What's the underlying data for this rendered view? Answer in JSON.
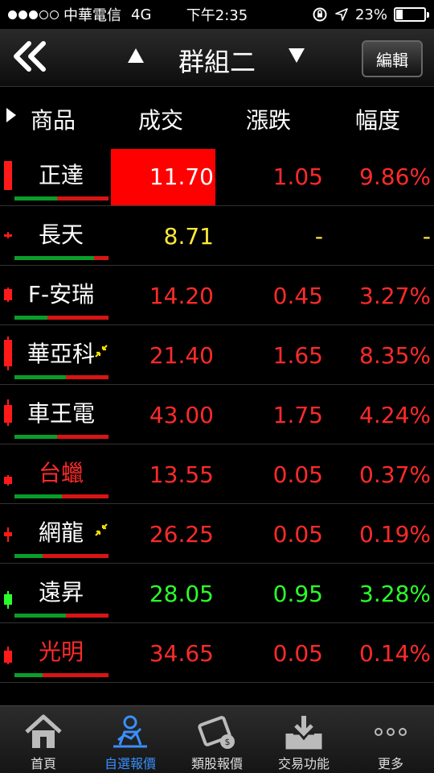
{
  "status": {
    "carrier": "中華電信",
    "network": "4G",
    "time": "下午2:35",
    "battery_pct": "23%",
    "battery_level": 0.23,
    "signal_bars_filled": 3,
    "signal_bars_total": 5
  },
  "header": {
    "back_label": "«",
    "title": "群組二",
    "prev_icon": "up-triangle-icon",
    "next_icon": "down-triangle-icon",
    "edit_label": "編輯"
  },
  "columns": {
    "name": "商品",
    "price": "成交",
    "change": "漲跌",
    "percent": "幅度"
  },
  "rows": [
    {
      "name": "正達",
      "name_color": "white",
      "price": "11.70",
      "price_color": "white",
      "price_highlight": true,
      "change": "1.05",
      "change_color": "red",
      "percent": "9.86%",
      "percent_color": "red",
      "flash": false,
      "green_ratio": 0.45,
      "candle_color": "#ff1a1a",
      "candle_wick": [
        0.1,
        0.9
      ],
      "candle_body": [
        0.1,
        0.9
      ]
    },
    {
      "name": "長天",
      "name_color": "white",
      "price": "8.71",
      "price_color": "yellow",
      "price_highlight": false,
      "change": "-",
      "change_color": "yellow",
      "percent": "-",
      "percent_color": "yellow",
      "flash": false,
      "green_ratio": 0.85,
      "candle_color": "#ff1a1a",
      "candle_wick": [
        0.4,
        0.6
      ],
      "candle_body": [
        0.47,
        0.53
      ]
    },
    {
      "name": "F-安瑞",
      "name_color": "white",
      "price": "14.20",
      "price_color": "red",
      "price_highlight": false,
      "change": "0.45",
      "change_color": "red",
      "percent": "3.27%",
      "percent_color": "red",
      "flash": false,
      "green_ratio": 0.35,
      "candle_color": "#ff1a1a",
      "candle_wick": [
        0.3,
        0.7
      ],
      "candle_body": [
        0.35,
        0.65
      ]
    },
    {
      "name": "華亞科",
      "name_color": "white",
      "price": "21.40",
      "price_color": "red",
      "price_highlight": false,
      "change": "1.65",
      "change_color": "red",
      "percent": "8.35%",
      "percent_color": "red",
      "flash": true,
      "green_ratio": 0.55,
      "candle_color": "#ff1a1a",
      "candle_wick": [
        0.0,
        0.95
      ],
      "candle_body": [
        0.1,
        0.85
      ]
    },
    {
      "name": "車王電",
      "name_color": "white",
      "price": "43.00",
      "price_color": "red",
      "price_highlight": false,
      "change": "1.75",
      "change_color": "red",
      "percent": "4.24%",
      "percent_color": "red",
      "flash": false,
      "green_ratio": 0.45,
      "candle_color": "#ff1a1a",
      "candle_wick": [
        0.1,
        0.85
      ],
      "candle_body": [
        0.25,
        0.75
      ]
    },
    {
      "name": "台蠟",
      "name_color": "red",
      "price": "13.55",
      "price_color": "red",
      "price_highlight": false,
      "change": "0.05",
      "change_color": "red",
      "percent": "0.37%",
      "percent_color": "red",
      "flash": false,
      "green_ratio": 0.5,
      "candle_color": "#ff1a1a",
      "candle_wick": [
        0.55,
        0.85
      ],
      "candle_body": [
        0.6,
        0.8
      ]
    },
    {
      "name": "網龍",
      "name_color": "white",
      "price": "26.25",
      "price_color": "red",
      "price_highlight": false,
      "change": "0.05",
      "change_color": "red",
      "percent": "0.19%",
      "percent_color": "red",
      "flash": true,
      "green_ratio": 0.3,
      "candle_color": "#ff1a1a",
      "candle_wick": [
        0.35,
        0.75
      ],
      "candle_body": [
        0.48,
        0.6
      ]
    },
    {
      "name": "遠昇",
      "name_color": "white",
      "price": "28.05",
      "price_color": "green",
      "price_highlight": false,
      "change": "0.95",
      "change_color": "green",
      "percent": "3.28%",
      "percent_color": "green",
      "flash": false,
      "green_ratio": 0.55,
      "candle_color": "#2bff2b",
      "candle_wick": [
        0.45,
        0.95
      ],
      "candle_body": [
        0.55,
        0.85
      ]
    },
    {
      "name": "光明",
      "name_color": "red",
      "price": "34.65",
      "price_color": "red",
      "price_highlight": false,
      "change": "0.05",
      "change_color": "red",
      "percent": "0.14%",
      "percent_color": "red",
      "flash": false,
      "green_ratio": 0.3,
      "candle_color": "#ff1a1a",
      "candle_wick": [
        0.35,
        0.85
      ],
      "candle_body": [
        0.45,
        0.8
      ]
    }
  ],
  "tabs": [
    {
      "label": "首頁",
      "icon": "home-icon",
      "active": false
    },
    {
      "label": "自選報價",
      "icon": "person-chart-icon",
      "active": true
    },
    {
      "label": "類股報價",
      "icon": "film-coin-icon",
      "active": false
    },
    {
      "label": "交易功能",
      "icon": "download-tray-icon",
      "active": false
    },
    {
      "label": "更多",
      "icon": "more-dots-icon",
      "active": false
    }
  ],
  "colors": {
    "red": "#ff2a2a",
    "green": "#2bff2b",
    "yellow": "#ffe93a",
    "highlight": "#ff0000",
    "active_tab": "#3a8fff"
  }
}
